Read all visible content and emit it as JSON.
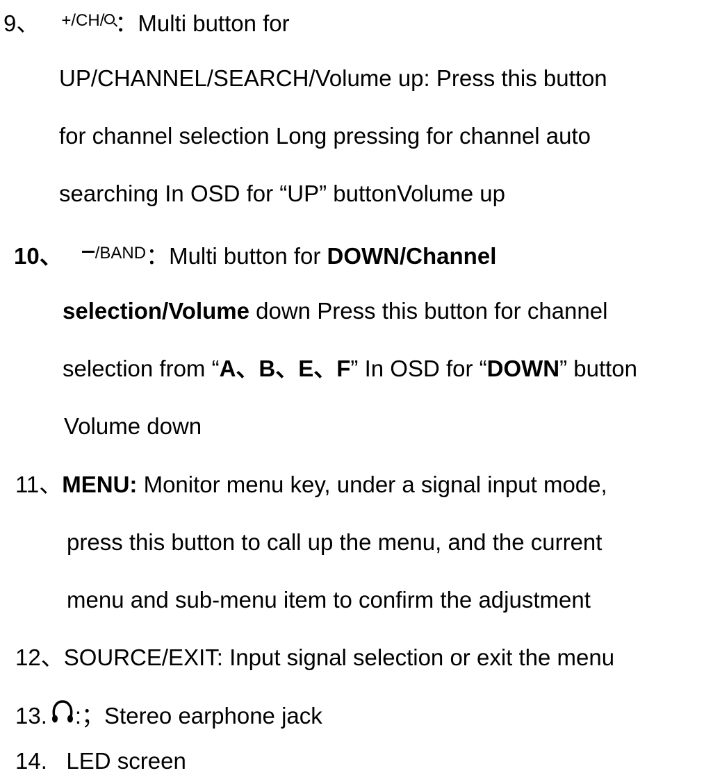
{
  "items": {
    "item9": {
      "number": "9、",
      "icon_plus": "+/CH/",
      "icon_name": "search-icon",
      "colon": "：",
      "head": "Multi button for",
      "lines": [
        "UP/CHANNEL/SEARCH/Volume up: Press this button",
        "for channel selection Long pressing for channel auto",
        "searching In OSD for “UP” buttonVolume up"
      ]
    },
    "item10": {
      "number": "10、",
      "icon_text": "/BAND",
      "icon_name": "minus-icon",
      "colon": "：",
      "head": "Multi button for ",
      "head_bold": "DOWN/Channel",
      "line2_bold": "selection/Volume",
      "line2_rest": " down Press this button for channel",
      "line3_a": "selection from “",
      "line3_b": "A、B、E、F",
      "line3_c": "” In OSD for “",
      "line3_d": "DOWN",
      "line3_e": "” button",
      "line4": "Volume down"
    },
    "item11": {
      "number": "11、",
      "label": "MENU:",
      "head": " Monitor menu key, under a signal input mode,",
      "lines": [
        "press this button to call up the menu, and the current",
        "menu and sub-menu item to confirm the adjustment"
      ]
    },
    "item12": {
      "text": "12、SOURCE/EXIT: Input signal selection or exit the menu"
    },
    "item13": {
      "number": "13.",
      "icon_name": "headphone-icon",
      "text": ":；Stereo earphone jack"
    },
    "item14": {
      "text": "14.   LED screen"
    }
  }
}
